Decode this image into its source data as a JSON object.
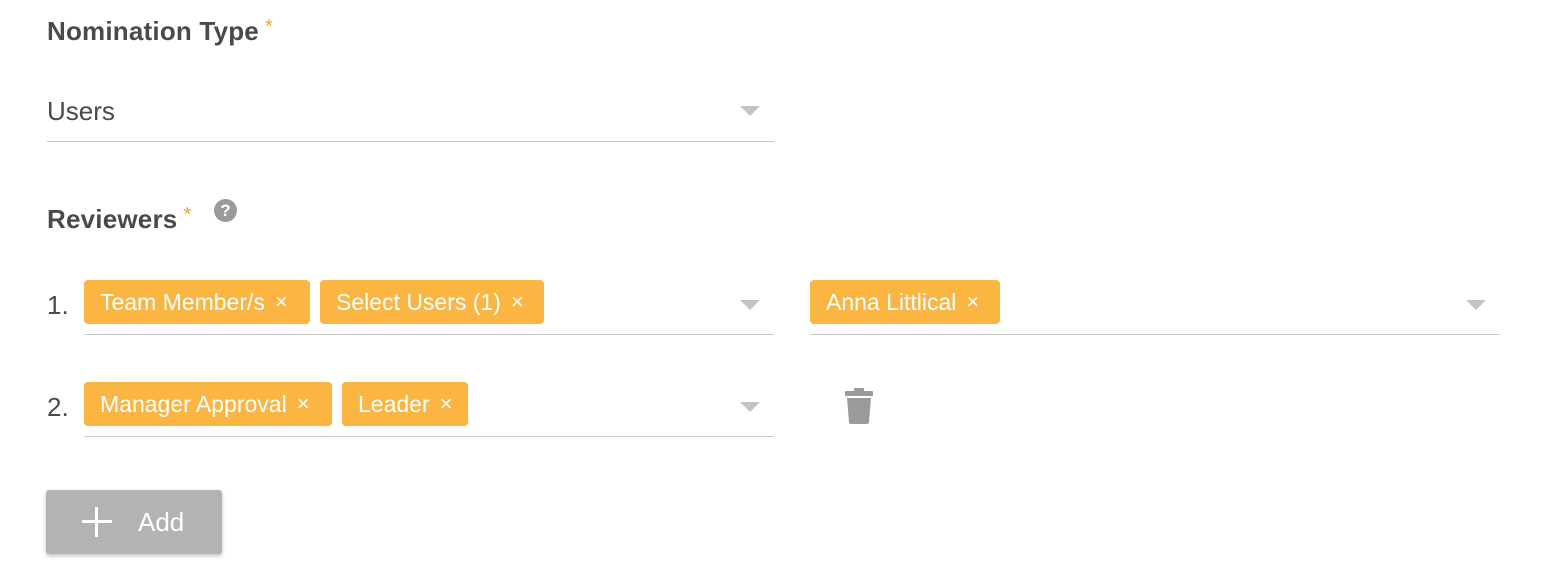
{
  "nomination_type": {
    "label": "Nomination Type",
    "required_mark": "*",
    "selected": "Users"
  },
  "reviewers": {
    "label": "Reviewers",
    "required_mark": "*",
    "help_icon": "question-icon",
    "rows": [
      {
        "number": "1.",
        "chips": [
          {
            "label": "Team Member/s",
            "remove": "×"
          },
          {
            "label": "Select Users (1)",
            "remove": "×"
          }
        ],
        "users": [
          {
            "label": "Anna Littlical",
            "remove": "×"
          }
        ]
      },
      {
        "number": "2.",
        "chips": [
          {
            "label": "Manager Approval",
            "remove": "×"
          },
          {
            "label": "Leader",
            "remove": "×"
          }
        ],
        "delete_icon": "trash-icon"
      }
    ]
  },
  "add_button": {
    "label": "Add",
    "icon": "plus-icon"
  },
  "colors": {
    "chip": "#fbb542",
    "required": "#f5a623",
    "button": "#b3b3b3"
  }
}
